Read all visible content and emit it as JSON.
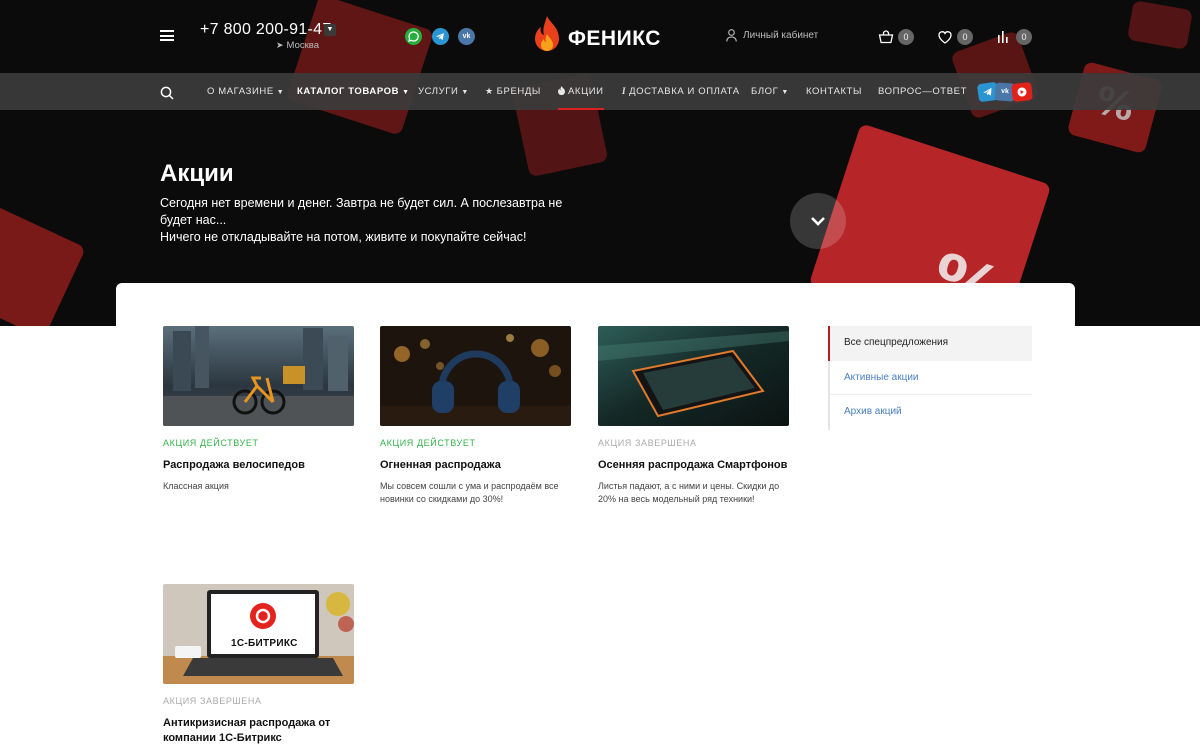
{
  "header": {
    "phone": "+7 800 200-91-47",
    "city": "Москва",
    "logo_text": "ФЕНИКС",
    "cabinet_label": "Личный кабинет",
    "cart_count": "0",
    "favorites_count": "0",
    "compare_count": "0",
    "messengers": [
      "whatsapp-icon",
      "telegram-icon",
      "vk-icon"
    ]
  },
  "nav": {
    "items": [
      {
        "label": "О магазине",
        "has_dropdown": true
      },
      {
        "label": "Каталог товаров",
        "has_dropdown": true,
        "bold": true
      },
      {
        "label": "Услуги",
        "has_dropdown": true
      },
      {
        "label": "Бренды",
        "icon": "star-icon"
      },
      {
        "label": "Акции",
        "icon": "fire-icon",
        "active": true
      },
      {
        "label": "Доставка и оплата",
        "icon": "info-icon"
      },
      {
        "label": "Блог",
        "has_dropdown": true
      },
      {
        "label": "Контакты"
      },
      {
        "label": "Вопрос—ответ"
      }
    ],
    "social": [
      "telegram-icon",
      "vk-icon",
      "youtube-icon"
    ]
  },
  "hero": {
    "title": "Акции",
    "line1": "Сегодня нет времени и денег. Завтра не будет сил. А послезавтра не будет нас...",
    "line2": "Ничего не откладывайте на потом, живите и покупайте сейчас!"
  },
  "cards": [
    {
      "status": "Акция действует",
      "state": "active",
      "title": "Распродажа велосипедов",
      "desc": "Классная акция",
      "image": "bicycle-photo"
    },
    {
      "status": "Акция действует",
      "state": "active",
      "title": "Огненная распродажа",
      "desc": "Мы совсем сошли с ума и распродаём все новинки со скидками до 30%!",
      "image": "headphones-photo"
    },
    {
      "status": "Акция завершена",
      "state": "ended",
      "title": "Осенняя распродажа Смартфонов",
      "desc": "Листья падают, а с ними и цены. Скидки до 20% на весь модельный ряд техники!",
      "image": "smartphone-photo"
    },
    {
      "status": "Акция завершена",
      "state": "ended",
      "title": "Антикризисная распродажа от компании 1С-Битрикс",
      "desc": "",
      "image": "laptop-photo",
      "image_text": "1С-БИТРИКС"
    }
  ],
  "sidebar": {
    "items": [
      {
        "label": "Все спецпредложения",
        "active": true
      },
      {
        "label": "Активные акции"
      },
      {
        "label": "Архив акций"
      }
    ]
  },
  "colors": {
    "accent": "#d8221d",
    "active_status": "#35b34a",
    "ended_status": "#aaaaaa",
    "link": "#4a7fc1"
  }
}
